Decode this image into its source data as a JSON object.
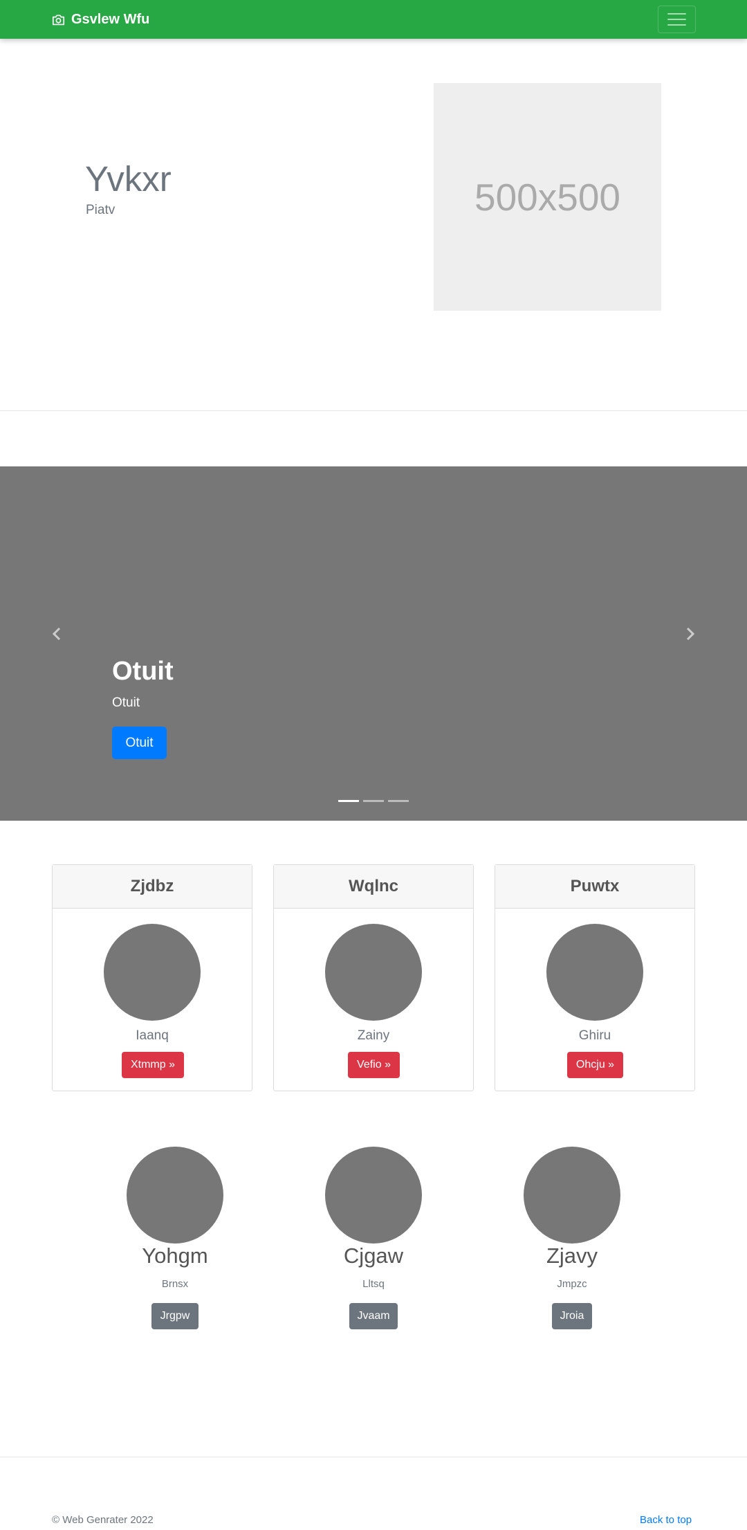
{
  "navbar": {
    "brand": "Gsvlew Wfu",
    "brand_icon": "camera-icon",
    "toggler_icon": "hamburger-icon",
    "background": "#28a745"
  },
  "hero": {
    "title": "Yvkxr",
    "subtitle": "Piatv",
    "placeholder_text": "500x500"
  },
  "carousel": {
    "caption_title": "Otuit",
    "caption_text": "Otuit",
    "button_label": "Otuit",
    "button_color": "#007bff",
    "slides_count": 3,
    "active_slide": 1
  },
  "cards": [
    {
      "title": "Zjdbz",
      "name": "Iaanq",
      "button": "Xtmmp »"
    },
    {
      "title": "Wqlnc",
      "name": "Zainy",
      "button": "Vefio »"
    },
    {
      "title": "Puwtx",
      "name": "Ghiru",
      "button": "Ohcju »"
    }
  ],
  "profiles": [
    {
      "name": "Yohgm",
      "subtitle": "Brnsx",
      "button": "Jrgpw"
    },
    {
      "name": "Cjgaw",
      "subtitle": "Lltsq",
      "button": "Jvaam"
    },
    {
      "name": "Zjavy",
      "subtitle": "Jmpzc",
      "button": "Jroia"
    }
  ],
  "footer": {
    "copyright": "© Web Genrater 2022",
    "back_to_top": "Back to top"
  },
  "colors": {
    "danger": "#dc3545",
    "secondary": "#6c757d",
    "carousel_bg": "#777777"
  }
}
